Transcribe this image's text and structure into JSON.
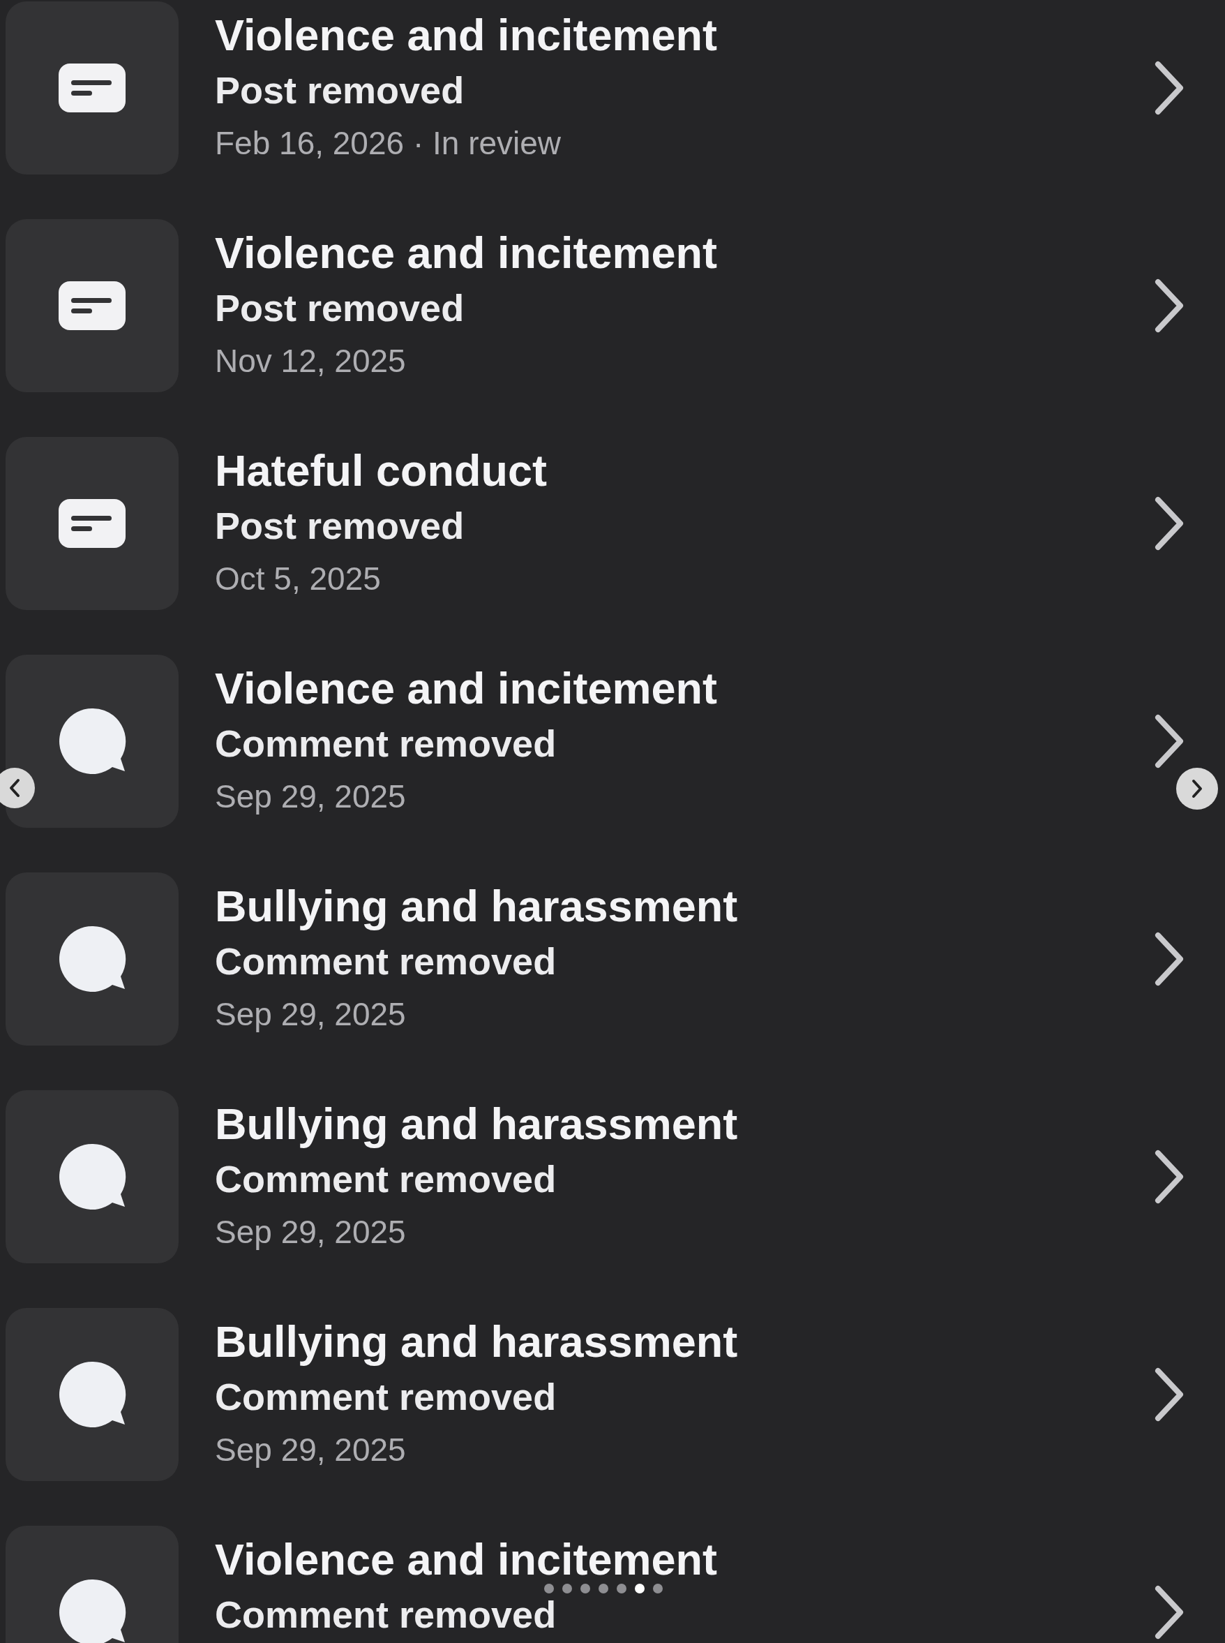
{
  "rows": [
    {
      "kind": "post",
      "title": "Violence and incitement",
      "action": "Post removed",
      "meta": "Feb 16, 2026 · In review"
    },
    {
      "kind": "post",
      "title": "Violence and incitement",
      "action": "Post removed",
      "meta": "Nov 12, 2025"
    },
    {
      "kind": "post",
      "title": "Hateful conduct",
      "action": "Post removed",
      "meta": "Oct 5, 2025"
    },
    {
      "kind": "comment",
      "title": "Violence and incitement",
      "action": "Comment removed",
      "meta": "Sep 29, 2025"
    },
    {
      "kind": "comment",
      "title": "Bullying and harassment",
      "action": "Comment removed",
      "meta": "Sep 29, 2025"
    },
    {
      "kind": "comment",
      "title": "Bullying and harassment",
      "action": "Comment removed",
      "meta": "Sep 29, 2025"
    },
    {
      "kind": "comment",
      "title": "Bullying and harassment",
      "action": "Comment removed",
      "meta": "Sep 29, 2025"
    },
    {
      "kind": "comment",
      "title": "Violence and incitement",
      "action": "Comment removed",
      "meta": ""
    }
  ],
  "carousel": {
    "pages": [
      {
        "selected": false
      },
      {
        "selected": false
      },
      {
        "selected": false
      },
      {
        "selected": false
      },
      {
        "selected": false
      },
      {
        "selected": true
      },
      {
        "selected": false
      }
    ]
  }
}
